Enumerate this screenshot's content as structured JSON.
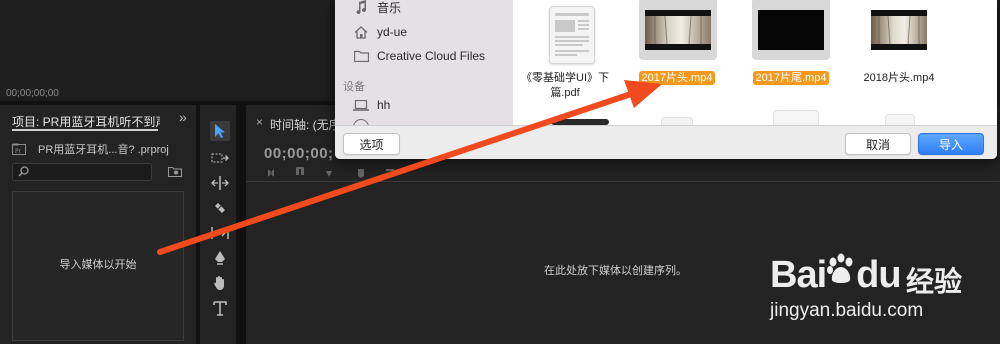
{
  "top_left": {
    "timecode": "00;00;00;00"
  },
  "project_panel": {
    "title": "项目: PR用蓝牙耳机听不到声音",
    "expand_glyph": "»",
    "file_name": "PR用蓝牙耳机...音? .prproj",
    "empty_message": "导入媒体以开始"
  },
  "timeline_panel": {
    "title": "时间轴: (无序",
    "close_glyph": "×",
    "timecode": "00;00;00;",
    "empty_message": "在此处放下媒体以创建序列。"
  },
  "dialog": {
    "sidebar": {
      "items": [
        {
          "label": "音乐",
          "icon": "music-icon"
        },
        {
          "label": "yd-ue",
          "icon": "home-icon"
        },
        {
          "label": "Creative Cloud Files",
          "icon": "folder-icon"
        }
      ],
      "section_header": "设备",
      "devices": [
        {
          "label": "hh",
          "icon": "laptop-icon"
        }
      ]
    },
    "files": [
      {
        "name": "《零基础学UI》下篇.pdf",
        "line1": "《零基础学UI》下",
        "line2": "篇.pdf",
        "kind": "pdf",
        "selected": false
      },
      {
        "name": "2017片头.mp4",
        "kind": "video-light",
        "selected": true
      },
      {
        "name": "2017片尾.mp4",
        "kind": "video-dark",
        "selected": true
      },
      {
        "name": "2018片头.mp4",
        "kind": "video-light",
        "selected": false
      }
    ],
    "buttons": {
      "options": "选项",
      "cancel": "取消",
      "import": "导入"
    }
  },
  "annotation": {
    "arrow_color": "#f04a1e"
  },
  "watermark": {
    "brand": "Bai",
    "brand2": "du",
    "cn": "经验",
    "url": "jingyan.baidu.com"
  }
}
